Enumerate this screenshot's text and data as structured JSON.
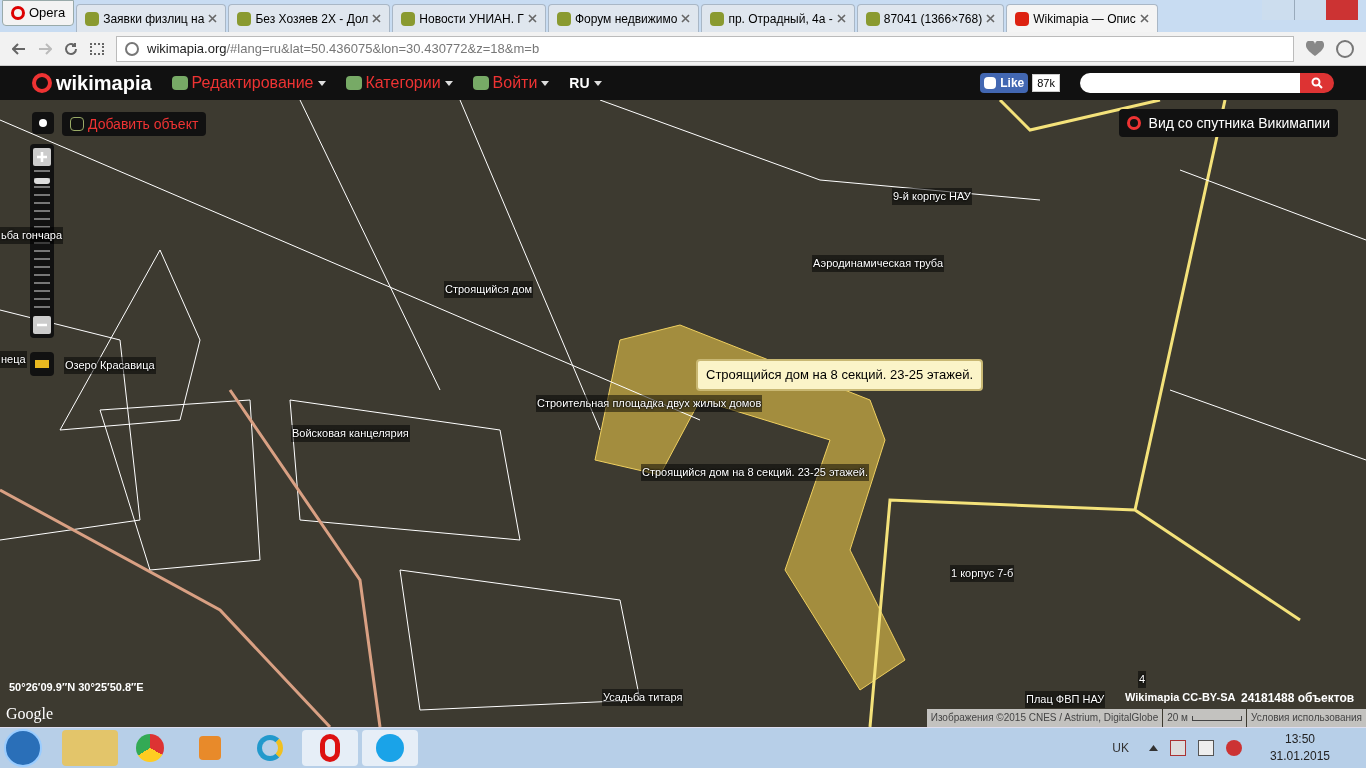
{
  "browser": {
    "menu_label": "Opera",
    "tabs": [
      {
        "title": "Заявки физлиц на",
        "selected": false
      },
      {
        "title": "Без Хозяев 2Х - Дол",
        "selected": false
      },
      {
        "title": "Новости УНИАН. Г",
        "selected": false
      },
      {
        "title": "Форум недвижимо",
        "selected": false
      },
      {
        "title": "пр. Отрадный, 4а -",
        "selected": false
      },
      {
        "title": "87041 (1366×768)",
        "selected": false
      },
      {
        "title": "Wikimapia — Опис",
        "selected": true
      }
    ],
    "url_host": "wikimapia.org",
    "url_rest": "/#lang=ru&lat=50.436075&lon=30.430772&z=18&m=b"
  },
  "header": {
    "logo": "wikimapia",
    "menu": [
      {
        "label": "Редактирование"
      },
      {
        "label": "Категории"
      },
      {
        "label": "Войти"
      }
    ],
    "language": "RU",
    "like_label": "Like",
    "like_count": "87k"
  },
  "map": {
    "add_object": "Добавить объект",
    "satellite_view": "Вид со спутника Викимапии",
    "zoom": {
      "level": 0.95
    },
    "labels": [
      {
        "text": "ьба гончара"
      },
      {
        "text": "неца"
      },
      {
        "text": "Озеро Красавица"
      },
      {
        "text": "Строящийся дом"
      },
      {
        "text": "9-й корпус НАУ"
      },
      {
        "text": "Аэродинамическая труба"
      },
      {
        "text": "Строительная площадка двух жилых домов"
      },
      {
        "text": "Войсковая канцелярия"
      },
      {
        "text": "Строящийся дом на 8 секций. 23-25 этажей."
      },
      {
        "text": "1 корпус 7-б"
      },
      {
        "text": "4"
      },
      {
        "text": "Усадьба титаря"
      },
      {
        "text": "Плац ФВП НАУ"
      }
    ],
    "tooltip": "Строящийся дом на 8 секций. 23-25 этажей.",
    "coordinates": "50°26′09.9″N 30°25′50.8″E",
    "google": "Google",
    "license": "Wikimapia CC-BY-SA",
    "objects_count": "24181488 объектов",
    "attribution": "Изображения ©2015 CNES / Astrium, DigitalGlobe",
    "scale": "20 м",
    "terms": "Условия использования"
  },
  "taskbar": {
    "language": "UK",
    "time": "13:50",
    "date": "31.01.2015"
  }
}
